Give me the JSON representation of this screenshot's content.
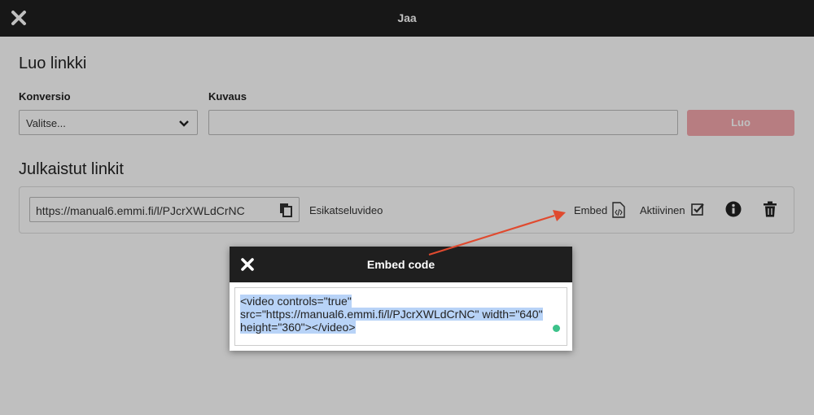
{
  "window": {
    "title": "Jaa"
  },
  "create_link": {
    "heading": "Luo linkki",
    "conversion_label": "Konversio",
    "conversion_value": "Valitse...",
    "description_label": "Kuvaus",
    "description_value": "",
    "create_button": "Luo"
  },
  "published": {
    "heading": "Julkaistut linkit",
    "url": "https://manual6.emmi.fi/l/PJcrXWLdCrNC",
    "preview": "Esikatseluvideo",
    "embed": "Embed",
    "active": "Aktiivinen"
  },
  "modal": {
    "title": "Embed code",
    "code_line1": "<video controls=\"true\"",
    "code_line2": "src=\"https://manual6.emmi.fi/l/PJcrXWLdCrNC\" width=\"640\"",
    "code_line3": "height=\"360\"></video>"
  },
  "colors": {
    "topbar": "#1f1f1f",
    "create_button": "#f4a7ad",
    "selection": "#b8d3f7",
    "arrow": "#e04a2f",
    "status_dot": "#3cc28a"
  }
}
